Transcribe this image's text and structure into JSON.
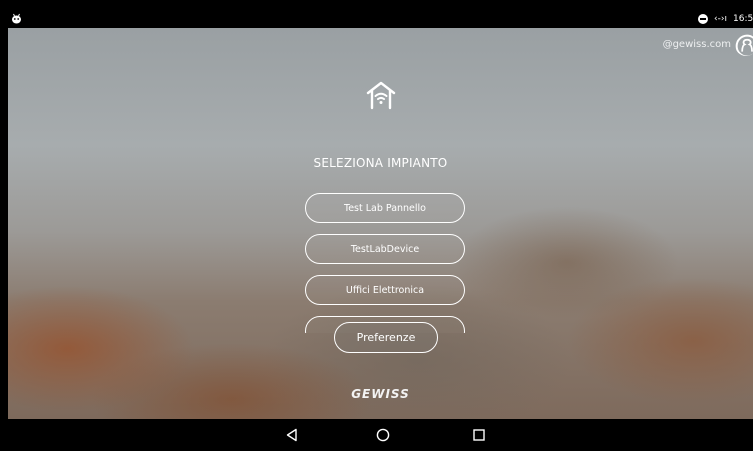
{
  "status_bar": {
    "app_icon": "android-icon",
    "dnd_icon": "do-not-disturb-icon",
    "sync_text": "‹-›ı",
    "time": "16:5"
  },
  "header": {
    "account": "@gewiss.com",
    "user_icon": "user-icon"
  },
  "main": {
    "home_icon": "home-wifi-icon",
    "title": "SELEZIONA IMPIANTO",
    "plants": [
      {
        "label": "Test Lab Pannello"
      },
      {
        "label": "TestLabDevice"
      },
      {
        "label": "Uffici Elettronica"
      },
      {
        "label": ""
      }
    ],
    "preferences_label": "Preferenze"
  },
  "footer": {
    "brand": "GEWISS"
  },
  "nav_bar": {
    "back_icon": "back-icon",
    "home_icon": "home-circle-icon",
    "recents_icon": "recents-icon"
  },
  "colors": {
    "accent": "#ffffff",
    "status_bar": "#000000",
    "nav_bar": "#000000"
  }
}
